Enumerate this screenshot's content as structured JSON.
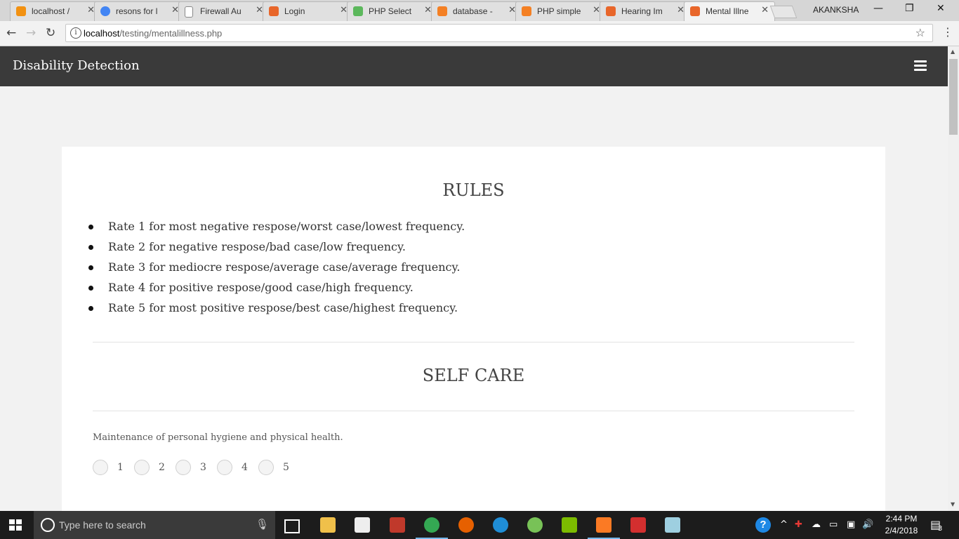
{
  "browser": {
    "tabs": [
      {
        "label": "localhost /",
        "favicon_color": "#f29111"
      },
      {
        "label": "resons for l",
        "favicon_color": "#4285f4"
      },
      {
        "label": "Firewall Au",
        "favicon_color": "#9e9e9e"
      },
      {
        "label": "Login",
        "favicon_color": "#e8662a"
      },
      {
        "label": "PHP Select",
        "favicon_color": "#5cb85c"
      },
      {
        "label": "database -",
        "favicon_color": "#f48024"
      },
      {
        "label": "PHP simple",
        "favicon_color": "#f48024"
      },
      {
        "label": "Hearing Im",
        "favicon_color": "#e8662a"
      },
      {
        "label": "Mental Illne",
        "favicon_color": "#e8662a",
        "active": true
      }
    ],
    "user": "AKANKSHA",
    "url_host": "localhost",
    "url_path": "/testing/mentalillness.php"
  },
  "app": {
    "brand": "Disability Detection",
    "menu_icon": "hamburger-menu-icon"
  },
  "rules": {
    "title": "RULES",
    "items": [
      "Rate 1 for most negative respose/worst case/lowest frequency.",
      "Rate 2 for negative respose/bad case/low frequency.",
      "Rate 3 for mediocre respose/average case/average frequency.",
      "Rate 4 for positive respose/good case/high frequency.",
      "Rate 5 for most positive respose/best case/highest frequency."
    ]
  },
  "self_care": {
    "title": "SELF CARE",
    "question": "Maintenance of personal hygiene and physical health.",
    "options": [
      "1",
      "2",
      "3",
      "4",
      "5"
    ]
  },
  "taskbar": {
    "search_placeholder": "Type here to search",
    "time": "2:44 PM",
    "date": "2/4/2018",
    "notification_count": "3"
  },
  "colors": {
    "navbar": "#3a3a3a",
    "page_bg": "#f2f2f2",
    "card_bg": "#ffffff",
    "taskbar": "#1c1c1c"
  }
}
